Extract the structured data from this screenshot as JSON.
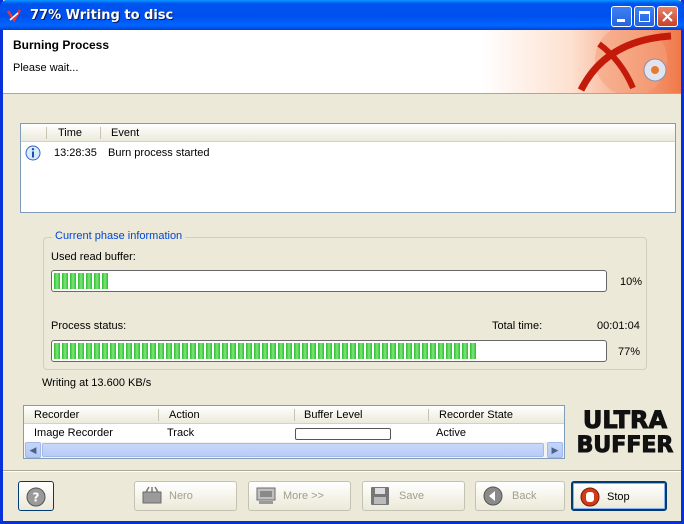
{
  "window": {
    "title": "77% Writing to disc"
  },
  "header": {
    "title": "Burning Process",
    "subtitle": "Please wait..."
  },
  "log": {
    "columns": [
      "Time",
      "Event"
    ],
    "rows": [
      {
        "icon": "info-icon",
        "time": "13:28:35",
        "event": "Burn process started"
      }
    ]
  },
  "phase": {
    "legend": "Current phase information",
    "buffer_label": "Used read buffer:",
    "buffer_value": 0.1,
    "buffer_pct": "10%",
    "status_label": "Process status:",
    "total_time_label": "Total time:",
    "total_time": "00:01:04",
    "status_value": 0.77,
    "status_pct": "77%"
  },
  "writing_speed": "Writing at 13.600 KB/s",
  "recorders": {
    "columns": [
      "Recorder",
      "Action",
      "Buffer Level",
      "Recorder State"
    ],
    "rows": [
      {
        "recorder": "Image Recorder",
        "action": "Track",
        "buffer": 0.0,
        "state": "Active"
      }
    ]
  },
  "branding": {
    "logo_text": [
      "ULTRA",
      "BUFFER"
    ]
  },
  "buttons": {
    "help": "?",
    "nero": "Nero",
    "more": "More >>",
    "save": "Save",
    "back": "Back",
    "stop": "Stop"
  },
  "colors": {
    "progress": "#2bbf2b",
    "title_bar": "#0053ee",
    "stop_icon": "#d23b17"
  }
}
